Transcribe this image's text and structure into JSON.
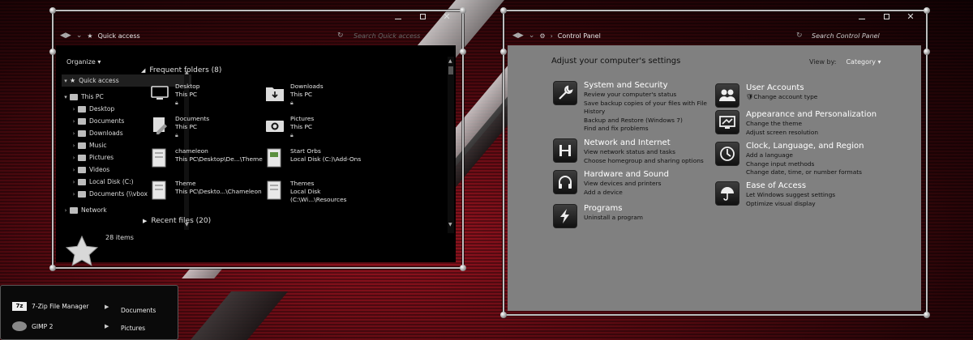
{
  "explorer": {
    "breadcrumb": "Quick access",
    "search_placeholder": "Search Quick access",
    "organize_label": "Organize",
    "nav": [
      {
        "label": "Quick access"
      },
      {
        "label": "This PC"
      },
      {
        "label": "Desktop"
      },
      {
        "label": "Documents"
      },
      {
        "label": "Downloads"
      },
      {
        "label": "Music"
      },
      {
        "label": "Pictures"
      },
      {
        "label": "Videos"
      },
      {
        "label": "Local Disk (C:)"
      },
      {
        "label": "Documents (\\\\vbox"
      },
      {
        "label": "Network"
      }
    ],
    "frequent_folders_header": "Frequent folders (8)",
    "folders": [
      {
        "name": "Desktop",
        "location": "This PC",
        "icon": "monitor-icon"
      },
      {
        "name": "Downloads",
        "location": "This PC",
        "icon": "download-folder-icon"
      },
      {
        "name": "Documents",
        "location": "This PC",
        "icon": "documents-icon"
      },
      {
        "name": "Pictures",
        "location": "This PC",
        "icon": "camera-icon"
      },
      {
        "name": "chameleon",
        "location": "This PC\\Desktop\\De...\\Theme",
        "icon": "folder-icon"
      },
      {
        "name": "Start Orbs",
        "location": "Local Disk (C:)\\Add-Ons",
        "icon": "folder-icon"
      },
      {
        "name": "Theme",
        "location": "This PC\\Deskto...\\Chameleon",
        "icon": "folder-icon"
      },
      {
        "name": "Themes",
        "location": "Local Disk (C:\\Wi...\\Resources",
        "icon": "folder-icon"
      }
    ],
    "recent_files_header": "Recent files (20)",
    "status": "28 items"
  },
  "cpanel": {
    "breadcrumb": "Control Panel",
    "search_placeholder": "Search Control Panel",
    "title": "Adjust your computer's settings",
    "view_by_label": "View by:",
    "view_by_value": "Category",
    "left_categories": [
      {
        "title": "System and Security",
        "icon": "wrench-icon",
        "links": [
          "Review your computer's status",
          "Save backup copies of your files with File",
          "History",
          "Backup and Restore (Windows 7)",
          "Find and fix problems"
        ]
      },
      {
        "title": "Network and Internet",
        "icon": "network-icon",
        "links": [
          "View network status and tasks",
          "Choose homegroup and sharing options"
        ]
      },
      {
        "title": "Hardware and Sound",
        "icon": "headphones-icon",
        "links": [
          "View devices and printers",
          "Add a device"
        ]
      },
      {
        "title": "Programs",
        "icon": "lightning-icon",
        "links": [
          "Uninstall a program"
        ]
      }
    ],
    "right_categories": [
      {
        "title": "User Accounts",
        "icon": "users-icon",
        "links": [
          "Change account type"
        ]
      },
      {
        "title": "Appearance and Personalization",
        "icon": "palette-icon",
        "links": [
          "Change the theme",
          "Adjust screen resolution"
        ]
      },
      {
        "title": "Clock, Language, and Region",
        "icon": "clock-icon",
        "links": [
          "Add a language",
          "Change input methods",
          "Change date, time, or number formats"
        ]
      },
      {
        "title": "Ease of Access",
        "icon": "umbrella-icon",
        "links": [
          "Let Windows suggest settings",
          "Optimize visual display"
        ]
      }
    ]
  },
  "startmenu": {
    "items": [
      {
        "label": "7-Zip File Manager",
        "icon": "7zip-icon"
      },
      {
        "label": "GIMP 2",
        "icon": "gimp-icon"
      }
    ],
    "right_items": [
      "Documents",
      "Pictures"
    ]
  },
  "colors": {
    "wallpaper_red": "#8a1018",
    "explorer_bg": "#000000",
    "cpanel_bg": "#808080",
    "frame": "#bdbdbd"
  }
}
